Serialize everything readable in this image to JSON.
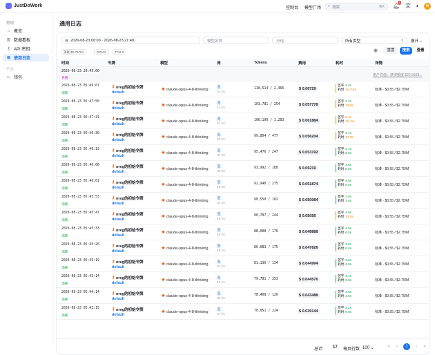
{
  "app": {
    "name": "JustDoWork"
  },
  "topbar": {
    "console": "控制台",
    "models": "模型广场",
    "search_placeholder": "搜索",
    "search_kbd": "⌘K",
    "notif_count": "1",
    "avatar": "N"
  },
  "sidebar": {
    "section1": "常规",
    "items": [
      {
        "label": "概览",
        "icon": "home-icon",
        "glyph": "⌂"
      },
      {
        "label": "数据看板",
        "icon": "chart-icon",
        "glyph": "▥"
      },
      {
        "label": "API 密钥",
        "icon": "key-icon",
        "glyph": "⚷"
      },
      {
        "label": "使用日志",
        "icon": "log-icon",
        "glyph": "≣",
        "active": true
      }
    ],
    "section2": "个人",
    "items2": [
      {
        "label": "钱包",
        "icon": "wallet-icon",
        "glyph": "▭"
      }
    ]
  },
  "page": {
    "title": "通用日志"
  },
  "filters": {
    "date_range": "2026-08-23 00:00 - 2026-08-23 21:49",
    "model_placeholder": "模型名称",
    "group_placeholder": "分组",
    "type_value": "所有类型",
    "expand": "展开",
    "stats": [
      "消耗 $0.79754",
      "RPM 0",
      "TPM 0"
    ],
    "reset": "重置",
    "search": "搜索",
    "view": "查看"
  },
  "table": {
    "headers": [
      "时间",
      "令牌",
      "模型",
      "流",
      "Tokens",
      "费用",
      "耗时",
      "详情"
    ],
    "first_row": {
      "time": "2026-08-23 20:49:00",
      "type": "充值",
      "detail": "用户充值，获得额度 $22.5938..."
    },
    "rows": [
      {
        "time": "2026-08-23 05:49:07",
        "type": "消耗",
        "token": "nreg的初始令牌",
        "group": "default",
        "model": "claude-opus-4-8-thinking",
        "stream": "流",
        "rate": "31 t/s",
        "tokens": "110,514 / 2,366",
        "cost": "$ 0.06729",
        "ttft": "4.4s",
        "total": "1m 16s",
        "ttft_color": "g",
        "total_color": "o",
        "detail": "标准 · $0.55 / $2.75/M"
      },
      {
        "time": "2026-08-23 05:47:50",
        "type": "消耗",
        "token": "nreg的初始令牌",
        "group": "default",
        "model": "claude-opus-4-8-thinking",
        "stream": "流",
        "rate": "14 t/s",
        "tokens": "103,781 / 254",
        "cost": "$ 0.057778",
        "ttft": "4.7s",
        "total": "18.0s",
        "ttft_color": "g",
        "total_color": "o",
        "detail": "标准 · $0.55 / $2.75/M"
      },
      {
        "time": "2026-08-23 05:47:31",
        "type": "消耗",
        "token": "nreg的初始令牌",
        "group": "default",
        "model": "claude-opus-4-8-thinking",
        "stream": "流",
        "rate": "21 t/s",
        "tokens": "106,100 / 1,283",
        "cost": "$ 0.061884",
        "ttft": "5.4s",
        "total": "1m 0s",
        "ttft_color": "o",
        "total_color": "o",
        "detail": "标准 · $0.55 / $2.75/M"
      },
      {
        "time": "2026-08-23 05:46:30",
        "type": "消耗",
        "token": "nreg的初始令牌",
        "group": "default",
        "model": "claude-opus-4-8-thinking",
        "stream": "流",
        "rate": "28 t/s",
        "tokens": "99,804 / 477",
        "cost": "$ 0.056204",
        "ttft": "4.7s",
        "total": "17.0s",
        "ttft_color": "g",
        "total_color": "o",
        "detail": "标准 · $0.55 / $2.75/M"
      },
      {
        "time": "2026-08-23 05:46:13",
        "type": "消耗",
        "token": "nreg的初始令牌",
        "group": "default",
        "model": "claude-opus-4-8-thinking",
        "stream": "流",
        "rate": "33 t/s",
        "tokens": "95,476 / 247",
        "cost": "$ 0.053192",
        "ttft": "3.1s",
        "total": "6.0s",
        "ttft_color": "g",
        "total_color": "g",
        "detail": "标准 · $0.55 / $2.75/M"
      },
      {
        "time": "2026-08-23 05:46:06",
        "type": "消耗",
        "token": "nreg的初始令牌",
        "group": "default",
        "model": "claude-opus-4-8-thinking",
        "stream": "流",
        "rate": "38 t/s",
        "tokens": "93,992 / 188",
        "cost": "$ 0.05219",
        "ttft": "2.8s",
        "total": "5.0s",
        "ttft_color": "g",
        "total_color": "g",
        "detail": "标准 · $0.55 / $2.75/M"
      },
      {
        "time": "2026-08-23 05:46:01",
        "type": "消耗",
        "token": "nreg的初始令牌",
        "group": "default",
        "model": "claude-opus-4-8-thinking",
        "stream": "流",
        "rate": "46 t/s",
        "tokens": "92,940 / 275",
        "cost": "$ 0.051874",
        "ttft": "4.5s",
        "total": "6.0s",
        "ttft_color": "g",
        "total_color": "g",
        "detail": "标准 · $0.55 / $2.75/M"
      },
      {
        "time": "2026-08-23 05:45:53",
        "type": "消耗",
        "token": "nreg的初始令牌",
        "group": "default",
        "model": "claude-opus-4-8-thinking",
        "stream": "流",
        "rate": "34 t/s",
        "tokens": "90,550 / 102",
        "cost": "$ 0.050084",
        "ttft": "2.0s",
        "total": "3.0s",
        "ttft_color": "g",
        "total_color": "g",
        "detail": "标准 · $0.55 / $2.75/M"
      },
      {
        "time": "2026-08-23 05:45:47",
        "type": "消耗",
        "token": "nreg的初始令牌",
        "group": "default",
        "model": "claude-opus-4-8-thinking",
        "stream": "流",
        "rate": "19 t/s",
        "tokens": "90,707 / 244",
        "cost": "$ 0.05056",
        "ttft": "4.6s",
        "total": "13.0s",
        "ttft_color": "g",
        "total_color": "o",
        "detail": "标准 · $0.55 / $2.75/M"
      },
      {
        "time": "2026-08-23 05:45:33",
        "type": "消耗",
        "token": "nreg的初始令牌",
        "group": "default",
        "model": "claude-opus-4-8-thinking",
        "stream": "流",
        "rate": "29 t/s",
        "tokens": "88,008 / 176",
        "cost": "$ 0.048888",
        "ttft": "4.9s",
        "total": "6.0s",
        "ttft_color": "g",
        "total_color": "g",
        "detail": "标准 · $0.55 / $2.75/M"
      },
      {
        "time": "2026-08-23 05:45:26",
        "type": "消耗",
        "token": "nreg的初始令牌",
        "group": "default",
        "model": "claude-opus-4-8-thinking",
        "stream": "流",
        "rate": "29 t/s",
        "tokens": "86,083 / 175",
        "cost": "$ 0.047826",
        "ttft": "3.6s",
        "total": "6.0s",
        "ttft_color": "g",
        "total_color": "g",
        "detail": "标准 · $0.55 / $2.75/M"
      },
      {
        "time": "2026-08-23 05:45:19",
        "type": "消耗",
        "token": "nreg的初始令牌",
        "group": "default",
        "model": "claude-opus-4-8-thinking",
        "stream": "流",
        "rate": "34 t/s",
        "tokens": "81,136 / 134",
        "cost": "$ 0.044994",
        "ttft": "3.6s",
        "total": "4.0s",
        "ttft_color": "g",
        "total_color": "g",
        "detail": "标准 · $0.55 / $2.75/M"
      },
      {
        "time": "2026-08-23 05:45:14",
        "type": "消耗",
        "token": "nreg的初始令牌",
        "group": "default",
        "model": "claude-opus-4-8-thinking",
        "stream": "流",
        "rate": "42 t/s",
        "tokens": "79,781 / 253",
        "cost": "$ 0.044576",
        "ttft": "4.1s",
        "total": "6.0s",
        "ttft_color": "g",
        "total_color": "g",
        "detail": "标准 · $0.55 / $2.75/M"
      },
      {
        "time": "2026-08-23 05:44:14",
        "type": "消耗",
        "token": "nreg的初始令牌",
        "group": "default",
        "model": "claude-opus-4-8-thinking",
        "stream": "流",
        "rate": "30 t/s",
        "tokens": "78,468 / 120",
        "cost": "$ 0.043488",
        "ttft": "3.6s",
        "total": "4.0s",
        "ttft_color": "g",
        "total_color": "g",
        "detail": "标准 · $0.55 / $2.75/M"
      },
      {
        "time": "2026-08-23 05:43:15",
        "type": "消耗",
        "token": "nreg的初始令牌",
        "group": "default",
        "model": "claude-opus-4-8-thinking",
        "stream": "流",
        "rate": "37 t/s",
        "tokens": "70,051 / 224",
        "cost": "$ 0.039144",
        "ttft": "3.2s",
        "total": "6.0s",
        "ttft_color": "g",
        "total_color": "g",
        "detail": "标准 · $0.55 / $2.75/M"
      }
    ],
    "ttft_label": "首字",
    "total_label": "耗时"
  },
  "pager": {
    "total_label": "总计:",
    "total": "17",
    "per_page_label": "每页行数",
    "per_page": "100",
    "current": "1"
  }
}
